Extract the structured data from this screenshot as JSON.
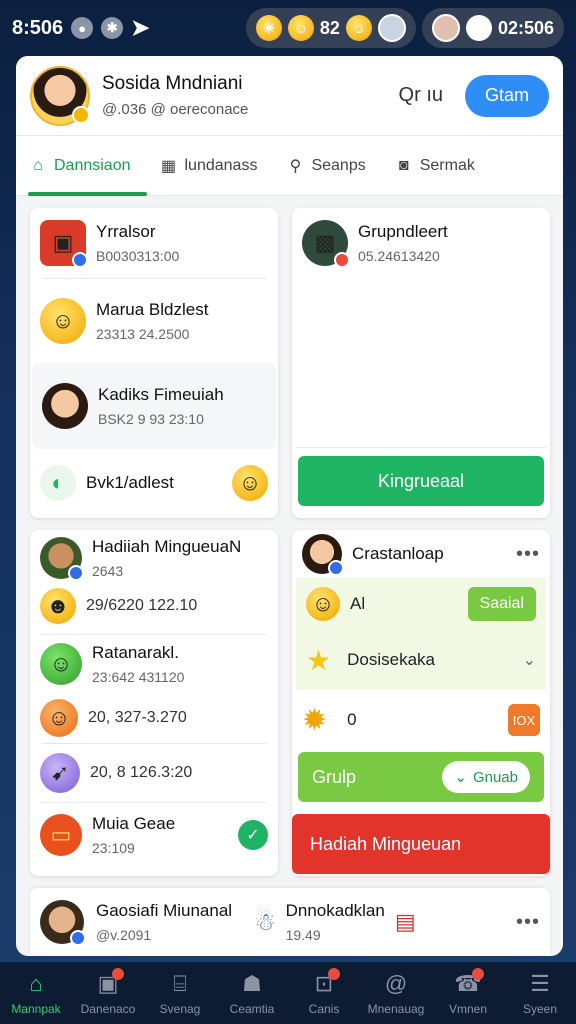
{
  "status": {
    "time": "8:506",
    "clock": "02:506",
    "count": "82"
  },
  "header": {
    "name": "Sosida Mndniani",
    "subtitle": "@.036 @ oereconace",
    "search_label": "Qr ıu",
    "button_label": "Gtam"
  },
  "tabs": [
    {
      "label": "Dannsiaon",
      "icon": "home-icon"
    },
    {
      "label": "lundanass",
      "icon": "calendar-icon"
    },
    {
      "label": "Seanps",
      "icon": "profile-icon"
    },
    {
      "label": "Sermak",
      "icon": "camera-icon"
    }
  ],
  "left_card_1": {
    "items": [
      {
        "title": "Yrralsor",
        "sub": "B0030313:00"
      },
      {
        "title": "Marua Bldzlest",
        "sub": "23313 24.2500"
      },
      {
        "title": "Kadiks Fimeuiah",
        "sub": "BSK2 9 93 23:10"
      },
      {
        "title": "Bvk1/adlest",
        "sub": ""
      }
    ]
  },
  "right_card_1": {
    "title": "Grupndleert",
    "sub": "05.24613420",
    "button": "Kingrueaal"
  },
  "left_card_2": {
    "items": [
      {
        "title": "Hadiiah MingueuaN",
        "sub": "2643"
      },
      {
        "title": "",
        "sub": "29/6220 122.10"
      },
      {
        "title": "Ratanarakl.",
        "sub": "23:642 431120"
      },
      {
        "title": "",
        "sub": "20, 327-3.270"
      },
      {
        "title": "",
        "sub": "20, 8 126.3:20"
      },
      {
        "title": "Muia Geae",
        "sub": "23:109"
      }
    ]
  },
  "right_card_2": {
    "title": "Crastanloap",
    "row1_text": "Al",
    "row1_pill": "Saaial",
    "row2_text": "Dosisekaka",
    "row3_text": "0",
    "row3_badge": "IOX",
    "lime_label": "Grulp",
    "lime_pill": "Gnuab",
    "red_label": "Hadiah Mingueuan"
  },
  "bottom_strip": {
    "left_title": "Gaosiafi Miunanal",
    "left_sub": "@v.2091",
    "right_title": "Dnnokadklan",
    "right_sub": "19.49"
  },
  "nav": [
    {
      "label": "Mannpak",
      "icon": "home-icon",
      "active": true
    },
    {
      "label": "Danenaco",
      "icon": "bag-icon",
      "badge": true
    },
    {
      "label": "Svenag",
      "icon": "store-icon"
    },
    {
      "label": "Ceamtia",
      "icon": "person-icon"
    },
    {
      "label": "Canis",
      "icon": "cart-icon",
      "badge": true
    },
    {
      "label": "Mnenauag",
      "icon": "at-icon"
    },
    {
      "label": "Vmnen",
      "icon": "chat-icon",
      "badge": true
    },
    {
      "label": "Syeen",
      "icon": "menu-icon"
    }
  ],
  "colors": {
    "primary_green": "#1fb364",
    "lime": "#7ac943",
    "red": "#e2342a",
    "blue": "#2f8ef5",
    "nav_bg": "#0d1b33"
  }
}
